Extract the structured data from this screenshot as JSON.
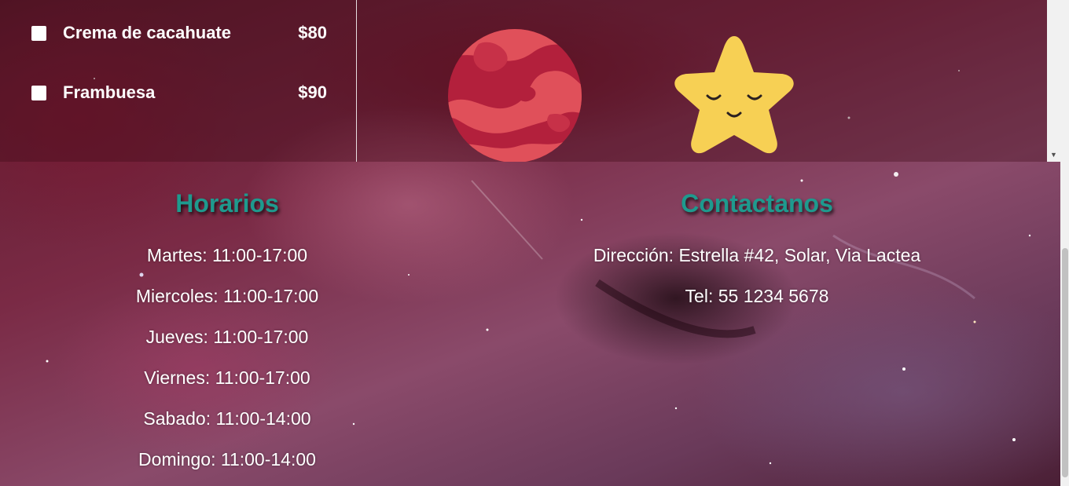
{
  "menu": {
    "items": [
      {
        "name": "Crema de cacahuate",
        "price": "$80",
        "checked": false
      },
      {
        "name": "Frambuesa",
        "price": "$90",
        "checked": false
      }
    ]
  },
  "images": {
    "planet": "planet-icon",
    "star": "smiling-star-icon"
  },
  "horarios": {
    "title": "Horarios",
    "lines": [
      "Martes: 11:00-17:00",
      "Miercoles: 11:00-17:00",
      "Jueves: 11:00-17:00",
      "Viernes: 11:00-17:00",
      "Sabado: 11:00-14:00",
      "Domingo: 11:00-14:00"
    ]
  },
  "contacto": {
    "title": "Contactanos",
    "lines": [
      "Dirección: Estrella #42, Solar, Via Lactea",
      "Tel: 55 1234 5678"
    ]
  },
  "colors": {
    "heading": "#1e9a8e",
    "text": "#ffffff",
    "planet_dark": "#b3203c",
    "planet_light": "#e0505a",
    "star": "#f7d054"
  }
}
